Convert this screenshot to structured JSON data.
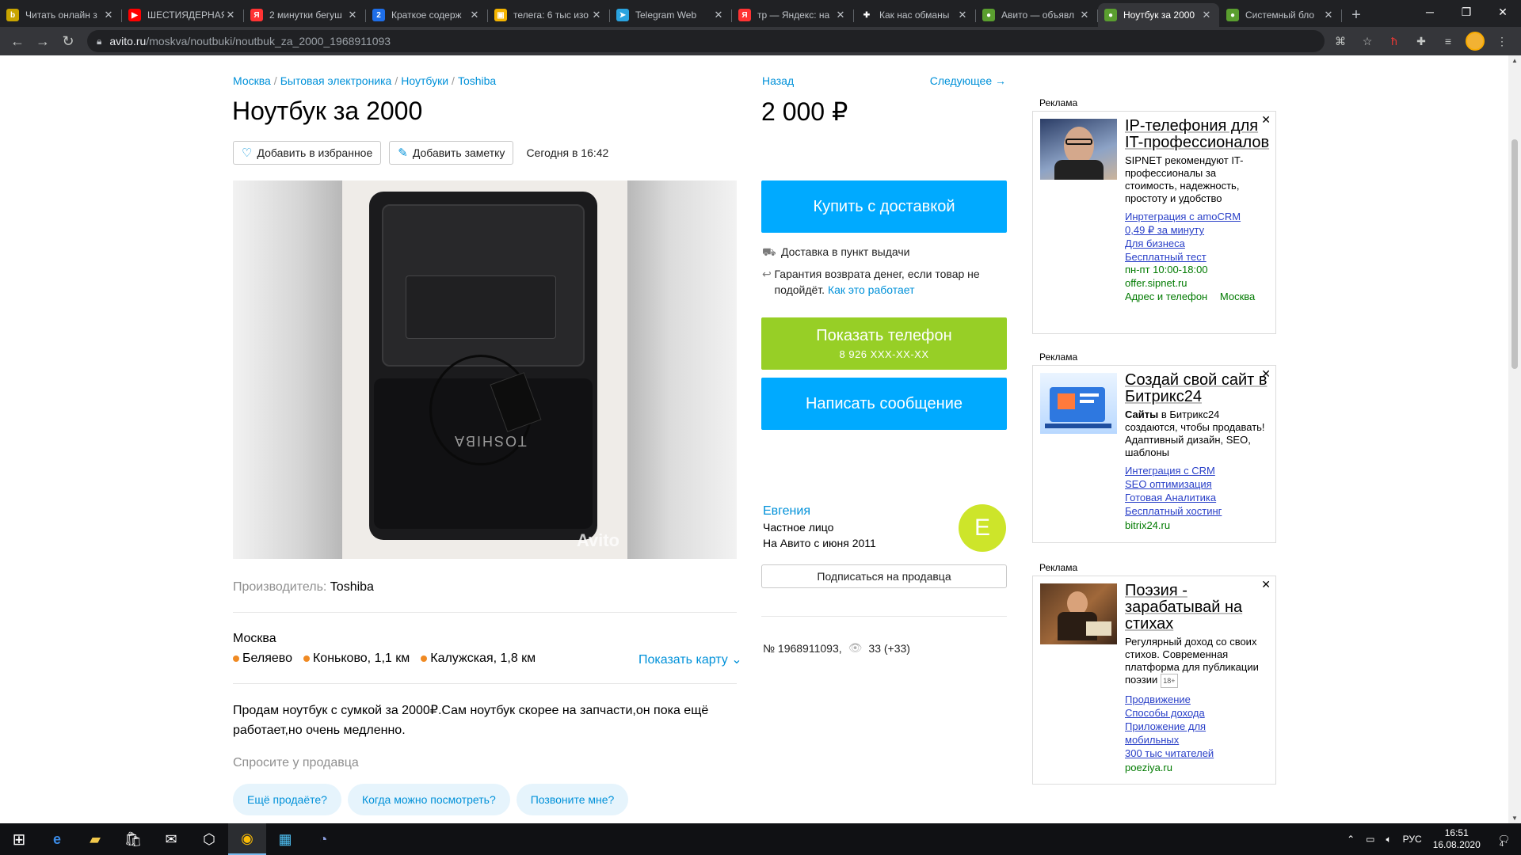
{
  "browser": {
    "tabs": [
      {
        "title": "Читать онлайн з",
        "favicon": "book-icon",
        "color": "#c8a400",
        "glyph": "b"
      },
      {
        "title": "ШЕСТИЯДЕРНАЯ",
        "favicon": "youtube-icon",
        "color": "#ff0000",
        "glyph": "▶"
      },
      {
        "title": "2 минутки бегуш",
        "favicon": "yandex-icon",
        "color": "#f33",
        "glyph": "Я"
      },
      {
        "title": "Краткое содерж",
        "favicon": "doc-icon",
        "color": "#1e6ee8",
        "glyph": "2"
      },
      {
        "title": "телега: 6 тыс изо",
        "favicon": "image-icon",
        "color": "#f4b400",
        "glyph": "▣"
      },
      {
        "title": "Telegram Web",
        "favicon": "telegram-icon",
        "color": "#2aa3df",
        "glyph": "➤"
      },
      {
        "title": "тр — Яндекс: на",
        "favicon": "yandex-icon",
        "color": "#f33",
        "glyph": "Я"
      },
      {
        "title": "Как нас обманы",
        "favicon": "plus-icon",
        "color": "#202124",
        "glyph": "✚"
      },
      {
        "title": "Авито — объявл",
        "favicon": "avito-icon",
        "color": "#5a9e2f",
        "glyph": "●"
      },
      {
        "title": "Ноутбук за 2000",
        "favicon": "avito-icon",
        "color": "#5a9e2f",
        "glyph": "●",
        "active": true
      },
      {
        "title": "Системный бло",
        "favicon": "avito-icon",
        "color": "#5a9e2f",
        "glyph": "●"
      }
    ],
    "url_host": "avito.ru",
    "url_path": "/moskva/noutbuki/noutbuk_za_2000_1968911093"
  },
  "listing": {
    "breadcrumbs": [
      "Москва",
      "Бытовая электроника",
      "Ноутбуки",
      "Toshiba"
    ],
    "title": "Ноутбук за 2000",
    "favorite_label": "Добавить в избранное",
    "note_label": "Добавить заметку",
    "date": "Сегодня в 16:42",
    "photo_brand": "TOSHIBA",
    "photo_watermark": "Avito",
    "spec_label": "Производитель:",
    "spec_value": "Toshiba",
    "city": "Москва",
    "metro": [
      "Беляево",
      "Коньково, 1,1 км",
      "Калужская, 1,8 км"
    ],
    "show_map": "Показать карту",
    "description": "Продам ноутбук с сумкой за 2000₽.Сам ноутбук скорее на запчасти,он пока ещё работает,но очень медленно.",
    "ask_seller": "Спросите у продавца",
    "quick_questions": [
      "Ещё продаёте?",
      "Когда можно посмотреть?",
      "Позвоните мне?"
    ]
  },
  "sidebar": {
    "back": "Назад",
    "next": "Следующее →",
    "price": "2 000 ₽",
    "buy_delivery": "Купить с доставкой",
    "delivery_note": "Доставка в пункт выдачи",
    "guarantee_text": "Гарантия возврата денег, если товар не подойдёт.",
    "guarantee_link": "Как это работает",
    "show_phone": "Показать телефон",
    "phone_masked": "8 926 XXX-XX-XX",
    "write_message": "Написать сообщение",
    "seller_name": "Евгения",
    "seller_type": "Частное лицо",
    "seller_since": "На Авито с июня 2011",
    "avatar_letter": "E",
    "subscribe": "Подписаться на продавца",
    "ad_number": "№ 1968911093,",
    "views": "33 (+33)"
  },
  "ads": [
    {
      "label": "Реклама",
      "headline": "IP-телефония для IT-профессионалов",
      "text": "SIPNET рекомендуют IT-профессионалы за стоимость, надежность, простоту и удобство",
      "links": [
        "Инртеграция с amoCRM",
        "0,49 ₽ за минуту",
        "Для бизнеса",
        "Бесплатный тест"
      ],
      "hours": "пн-пт 10:00-18:00",
      "domain": "offer.sipnet.ru",
      "extra1": "Адрес и телефон",
      "extra2": "Москва"
    },
    {
      "label": "Реклама",
      "headline": "Создай свой сайт в Битрикс24",
      "text_bold": "Сайты",
      "text": " в Битрикс24 создаются, чтобы продавать! Адаптивный дизайн, SEO, шаблоны",
      "links": [
        "Интеграция с CRM",
        "SEO оптимизация",
        "Готовая Аналитика",
        "Бесплатный хостинг"
      ],
      "domain": "bitrix24.ru"
    },
    {
      "label": "Реклама",
      "headline": "Поэзия - зарабатывай на стихах",
      "text": "Регулярный доход со своих стихов. Современная платформа для публикации поэзии",
      "age": "18+",
      "links": [
        "Продвижение",
        "Способы дохода",
        "Приложение для мобильных",
        "300 тыс читателей"
      ],
      "domain": "poeziya.ru"
    }
  ],
  "taskbar": {
    "lang": "РУС",
    "time": "16:51",
    "date": "16.08.2020",
    "notif_count": "4"
  }
}
